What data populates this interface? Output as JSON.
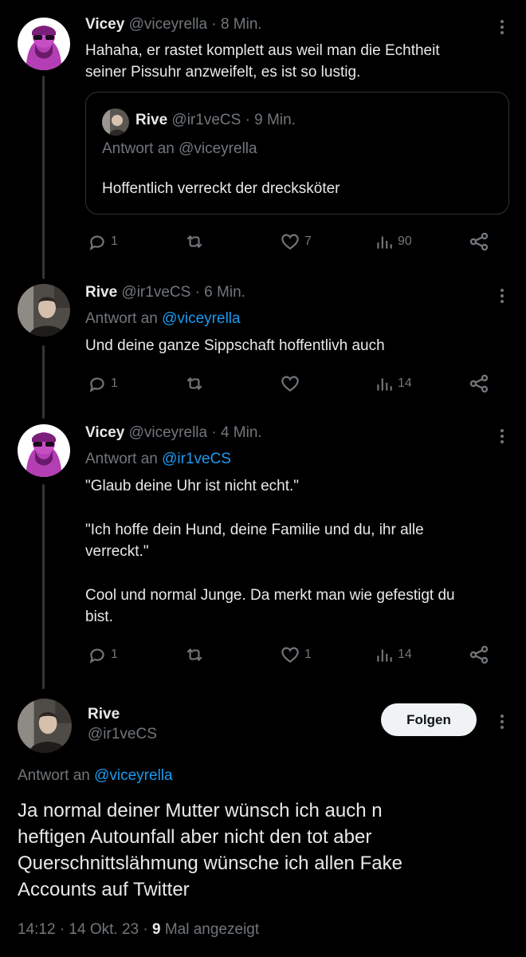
{
  "tweets": [
    {
      "name": "Vicey",
      "handle": "@viceyrella",
      "time": "· 8 Min.",
      "text_line1": "Hahaha, er rastet komplett aus weil man die Echtheit",
      "text_line2": "seiner Pissuhr anzweifelt, es ist so lustig.",
      "quote": {
        "name": "Rive",
        "handle": "@ir1veCS",
        "time": "· 9 Min.",
        "reply_prefix": "Antwort an",
        "reply_handle": "@viceyrella",
        "text": "Hoffentlich verreckt der drecksköter"
      },
      "replies": "1",
      "retweets": "",
      "likes": "7",
      "views": "90"
    },
    {
      "name": "Rive",
      "handle": "@ir1veCS",
      "time": "· 6 Min.",
      "reply_prefix": "Antwort an",
      "reply_handle": "@viceyrella",
      "text": "Und deine ganze Sippschaft hoffentlivh auch",
      "replies": "1",
      "retweets": "",
      "likes": "",
      "views": "14"
    },
    {
      "name": "Vicey",
      "handle": "@viceyrella",
      "time": "· 4 Min.",
      "reply_prefix": "Antwort an",
      "reply_handle": "@ir1veCS",
      "p1": "\"Glaub deine Uhr ist nicht echt.\"",
      "p2_line1": "\"Ich hoffe dein Hund, deine Familie und du, ihr alle",
      "p2_line2": "verreckt.\"",
      "p3_line1": "Cool und normal Junge. Da merkt man wie gefestigt du",
      "p3_line2": "bist.",
      "replies": "1",
      "retweets": "",
      "likes": "1",
      "views": "14"
    }
  ],
  "main_tweet": {
    "name": "Rive",
    "handle": "@ir1veCS",
    "follow_label": "Folgen",
    "reply_prefix": "Antwort an",
    "reply_handle": "@viceyrella",
    "line1": "Ja normal deiner Mutter wünsch ich auch n",
    "line2": "heftigen Autounfall aber nicht den tot aber",
    "line3": "Querschnittslähmung wünsche ich allen Fake",
    "line4": "Accounts auf Twitter",
    "timestamp": "14:12 · 14 Okt. 23 · ",
    "views_count": "9",
    "views_label": " Mal angezeigt"
  },
  "colors": {
    "background": "#000000",
    "text": "#e7e9ea",
    "muted": "#71767b",
    "link": "#1d9bf0",
    "avatar_vicey": "#c64fc6"
  },
  "icons": [
    "reply-icon",
    "retweet-icon",
    "like-icon",
    "views-icon",
    "share-icon",
    "more-icon"
  ]
}
